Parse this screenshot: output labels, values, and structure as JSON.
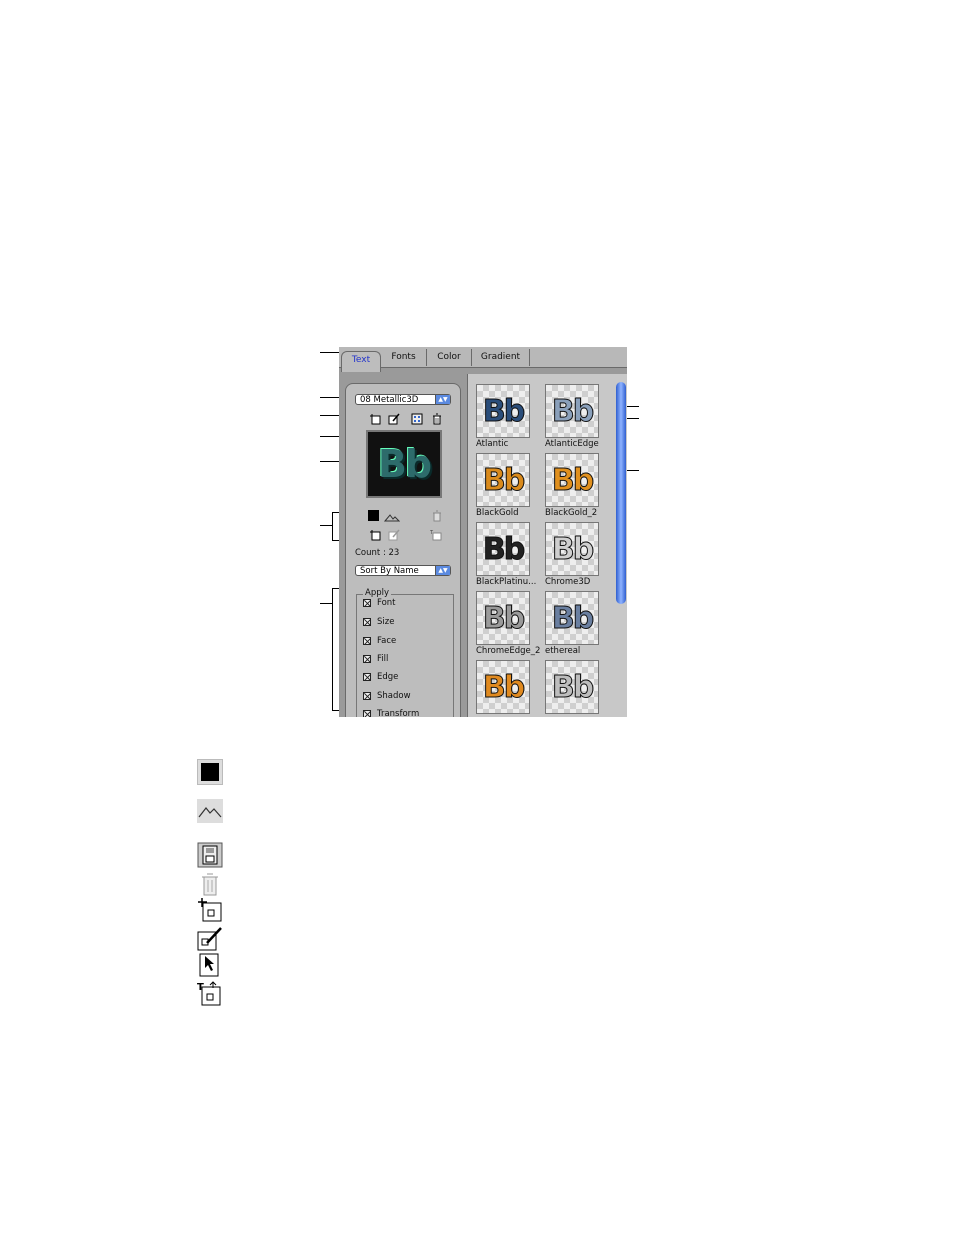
{
  "tabs": [
    {
      "label": "Text",
      "active": true
    },
    {
      "label": "Fonts",
      "active": false
    },
    {
      "label": "Color",
      "active": false
    },
    {
      "label": "Gradient",
      "active": false
    }
  ],
  "style_set": {
    "selected": "08 Metallic3D"
  },
  "count_label": "Count : 23",
  "sort": {
    "selected": "Sort By Name"
  },
  "apply": {
    "title": "Apply",
    "items": [
      "Font",
      "Size",
      "Face",
      "Fill",
      "Edge",
      "Shadow",
      "Transform"
    ]
  },
  "styles": [
    {
      "name": "Atlantic",
      "glyph": "Bb",
      "color": "#2a4d7a"
    },
    {
      "name": "AtlanticEdge",
      "glyph": "Bb",
      "color": "#8aa0bb"
    },
    {
      "name": "BlackGold",
      "glyph": "Bb",
      "color": "#d98a1c"
    },
    {
      "name": "BlackGold_2",
      "glyph": "Bb",
      "color": "#e0901e"
    },
    {
      "name": "BlackPlatinu...",
      "glyph": "Bb",
      "color": "#222222"
    },
    {
      "name": "Chrome3D",
      "glyph": "Bb",
      "color": "#cfcfcf"
    },
    {
      "name": "ChromeEdge_2",
      "glyph": "Bb",
      "color": "#9a9a9a"
    },
    {
      "name": "ethereal",
      "glyph": "Bb",
      "color": "#6a7fa0"
    },
    {
      "name": "",
      "glyph": "Bb",
      "color": "#e08a20"
    },
    {
      "name": "",
      "glyph": "Bb",
      "color": "#bdbdbd"
    }
  ],
  "preview_glyph": "Bb",
  "icon_names": [
    "new-style-icon",
    "edit-style-icon",
    "grid-icon",
    "trash-icon",
    "color-swatch-icon",
    "landscape-icon",
    "save-icon",
    "trash-disabled-icon",
    "new-icon",
    "edit-icon",
    "select-icon",
    "text-style-icon"
  ]
}
